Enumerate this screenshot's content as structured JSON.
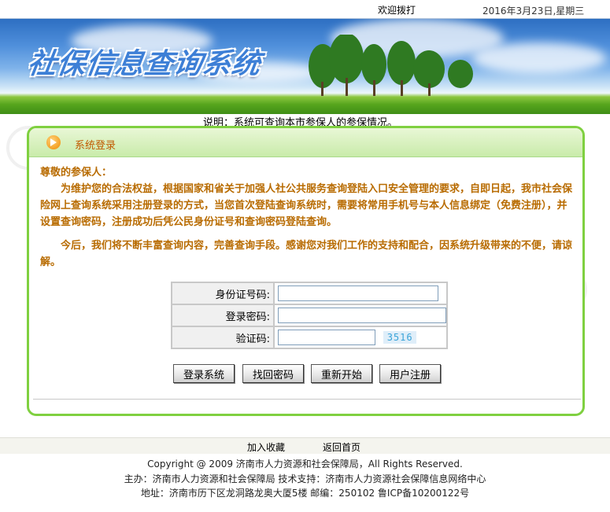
{
  "topbar": {
    "welcome": "欢迎拨打",
    "date": "2016年3月23日,星期三"
  },
  "banner": {
    "title": "社保信息查询系统"
  },
  "notice": "说明：系统可查询本市参保人的参保情况。",
  "panel": {
    "title": "系统登录",
    "greeting": "尊敬的参保人：",
    "paragraph1": "为维护您的合法权益，根据国家和省关于加强人社公共服务查询登陆入口安全管理的要求，自即日起，我市社会保险网上查询系统采用注册登录的方式，当您首次登陆查询系统时，需要将常用手机号与本人信息绑定（免费注册），并设置查询密码，注册成功后凭公民身份证号和查询密码登陆查询。",
    "paragraph2": "今后，我们将不断丰富查询内容，完善查询手段。感谢您对我们工作的支持和配合，因系统升级带来的不便，请谅解。"
  },
  "form": {
    "id_label": "身份证号码:",
    "id_value": "",
    "password_label": "登录密码:",
    "password_value": "",
    "captcha_label": "验证码:",
    "captcha_value": "",
    "captcha_code": "3516"
  },
  "buttons": {
    "login": "登录系统",
    "retrieve": "找回密码",
    "reset": "重新开始",
    "register": "用户注册"
  },
  "footer": {
    "favorite": "加入收藏",
    "home": "返回首页",
    "copyright": "Copyright @ 2009 济南市人力资源和社会保障局，All Rights Reserved.",
    "host": "主办：济南市人力资源和社会保障局    技术支持：济南市人力资源社会保障信息网络中心",
    "address": "地址：济南市历下区龙洞路龙奥大厦5楼    邮编：250102    鲁ICP备10200122号"
  },
  "colors": {
    "panel_border": "#7fd040",
    "body_text": "#b86b00",
    "head_text": "#c15a00",
    "captcha_text": "#39a3d8"
  }
}
